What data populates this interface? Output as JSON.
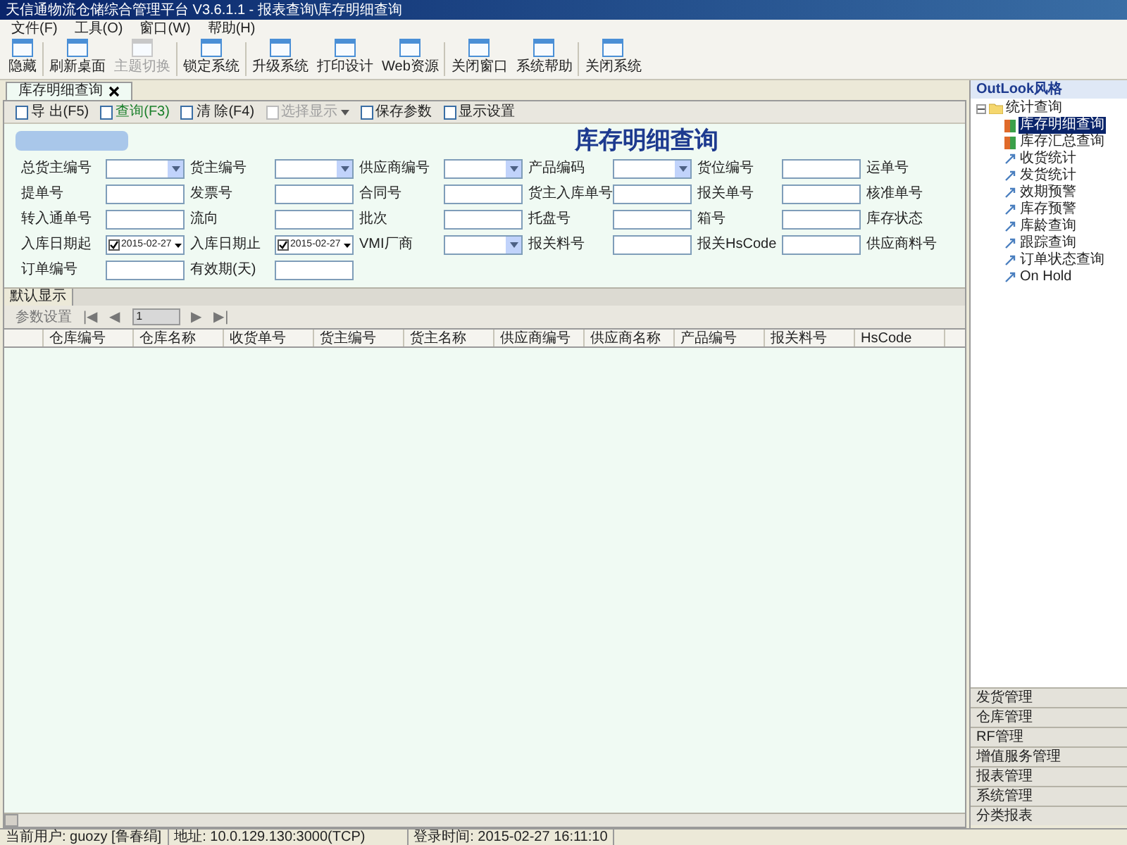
{
  "window": {
    "title": "天信通物流仓储综合管理平台 V3.6.1.1 - 报表查询\\库存明细查询"
  },
  "menu": [
    "文件(F)",
    "工具(O)",
    "窗口(W)",
    "帮助(H)"
  ],
  "toolbar": [
    {
      "label": "隐藏",
      "disabled": false
    },
    {
      "label": "刷新桌面",
      "disabled": false
    },
    {
      "label": "主题切换",
      "disabled": true
    },
    {
      "label": "锁定系统",
      "disabled": false
    },
    {
      "label": "升级系统",
      "disabled": false
    },
    {
      "label": "打印设计",
      "disabled": false
    },
    {
      "label": "Web资源",
      "disabled": false
    },
    {
      "label": "关闭窗口",
      "disabled": false
    },
    {
      "label": "系统帮助",
      "disabled": false
    },
    {
      "label": "关闭系统",
      "disabled": false
    }
  ],
  "tabs": [
    {
      "label": "库存明细查询",
      "selected": true
    }
  ],
  "actions": [
    {
      "label": "导 出(F5)",
      "disabled": false,
      "dropdown": false
    },
    {
      "label": "查询(F3)",
      "disabled": false,
      "dropdown": false
    },
    {
      "label": "清 除(F4)",
      "disabled": false,
      "dropdown": false
    },
    {
      "label": "选择显示",
      "disabled": true,
      "dropdown": true
    },
    {
      "label": "保存参数",
      "disabled": false,
      "dropdown": false
    },
    {
      "label": "显示设置",
      "disabled": false,
      "dropdown": false
    }
  ],
  "header": {
    "title": "库存明细查询"
  },
  "filters": [
    [
      {
        "label": "总货主编号",
        "kind": "combo"
      },
      {
        "label": "货主编号",
        "kind": "combo"
      },
      {
        "label": "供应商编号",
        "kind": "combo"
      },
      {
        "label": "产品编码",
        "kind": "combo"
      },
      {
        "label": "货位编号",
        "kind": "text"
      },
      {
        "label": "运单号",
        "kind": "none"
      }
    ],
    [
      {
        "label": "提单号",
        "kind": "text"
      },
      {
        "label": "发票号",
        "kind": "text"
      },
      {
        "label": "合同号",
        "kind": "text"
      },
      {
        "label": "货主入库单号",
        "kind": "text"
      },
      {
        "label": "报关单号",
        "kind": "text"
      },
      {
        "label": "核准单号",
        "kind": "none"
      }
    ],
    [
      {
        "label": "转入通单号",
        "kind": "text"
      },
      {
        "label": "流向",
        "kind": "text"
      },
      {
        "label": "批次",
        "kind": "text"
      },
      {
        "label": "托盘号",
        "kind": "text"
      },
      {
        "label": "箱号",
        "kind": "text"
      },
      {
        "label": "库存状态",
        "kind": "none"
      }
    ],
    [
      {
        "label": "入库日期起",
        "kind": "date",
        "checked": true,
        "value": "2015-02-27"
      },
      {
        "label": "入库日期止",
        "kind": "date",
        "checked": true,
        "value": "2015-02-27"
      },
      {
        "label": "VMI厂商",
        "kind": "combo"
      },
      {
        "label": "报关料号",
        "kind": "text"
      },
      {
        "label": "报关HsCode",
        "kind": "text"
      },
      {
        "label": "供应商料号",
        "kind": "none"
      }
    ],
    [
      {
        "label": "订单编号",
        "kind": "text"
      },
      {
        "label": "有效期(天)",
        "kind": "text"
      }
    ]
  ],
  "results": {
    "tabs": [
      {
        "label": "默认显示",
        "selected": true
      }
    ],
    "pager": {
      "settings": "参数设置",
      "first": "|◀",
      "prev": "◀",
      "page": "1",
      "next": "▶",
      "last": "▶|"
    },
    "columns": [
      "仓库编号",
      "仓库名称",
      "收货单号",
      "货主编号",
      "货主名称",
      "供应商编号",
      "供应商名称",
      "产品编号",
      "报关料号",
      "HsCode"
    ]
  },
  "status_bar": [
    "当前用户: guozy [鲁春绢]",
    "地址: 10.0.129.130:3000(TCP)",
    "登录时间: 2015-02-27 16:11:10"
  ],
  "side_panel": {
    "title": "OutLook风格",
    "tree": [
      {
        "label": "统计查询",
        "expanded": true,
        "children": [
          {
            "label": "库存明细查询",
            "selected": true,
            "kind": "report"
          },
          {
            "label": "库存汇总查询",
            "selected": false,
            "kind": "report"
          },
          {
            "label": "收货统计",
            "selected": false,
            "kind": "link"
          },
          {
            "label": "发货统计",
            "selected": false,
            "kind": "link"
          },
          {
            "label": "效期预警",
            "selected": false,
            "kind": "link"
          },
          {
            "label": "库存预警",
            "selected": false,
            "kind": "link"
          },
          {
            "label": "库龄查询",
            "selected": false,
            "kind": "link"
          },
          {
            "label": "跟踪查询",
            "selected": false,
            "kind": "link"
          },
          {
            "label": "订单状态查询",
            "selected": false,
            "kind": "link"
          },
          {
            "label": "On Hold",
            "selected": false,
            "kind": "link"
          }
        ]
      }
    ],
    "sections": [
      "发货管理",
      "仓库管理",
      "RF管理",
      "增值服务管理",
      "报表管理",
      "系统管理",
      "分类报表"
    ]
  }
}
